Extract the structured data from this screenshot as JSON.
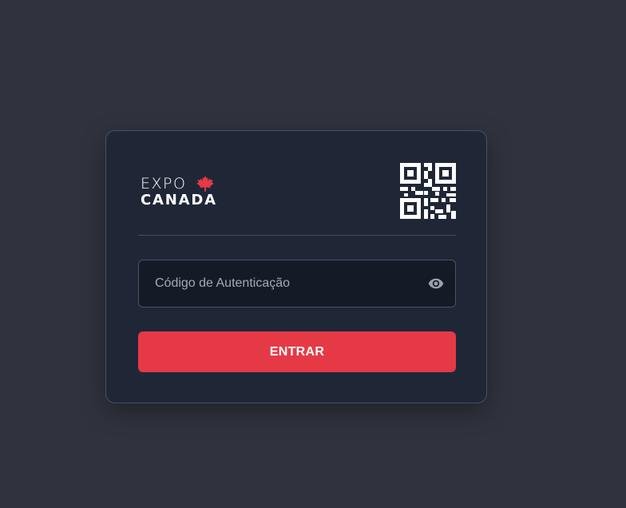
{
  "logo": {
    "line1": "EXPO",
    "line2": "CANADA",
    "icon": "maple-leaf-icon",
    "accent_color": "#e63946"
  },
  "qr": {
    "icon": "qr-code-icon"
  },
  "auth_form": {
    "code_placeholder": "Código de Autenticação",
    "code_value": "",
    "visibility_icon": "eye-icon",
    "submit_label": "ENTRAR"
  },
  "colors": {
    "page_background": "#30333e",
    "card_background": "#1f2737",
    "input_background": "#151b26",
    "button_background": "#e63946",
    "text_primary": "#ffffff",
    "placeholder": "#a3a9b5"
  }
}
